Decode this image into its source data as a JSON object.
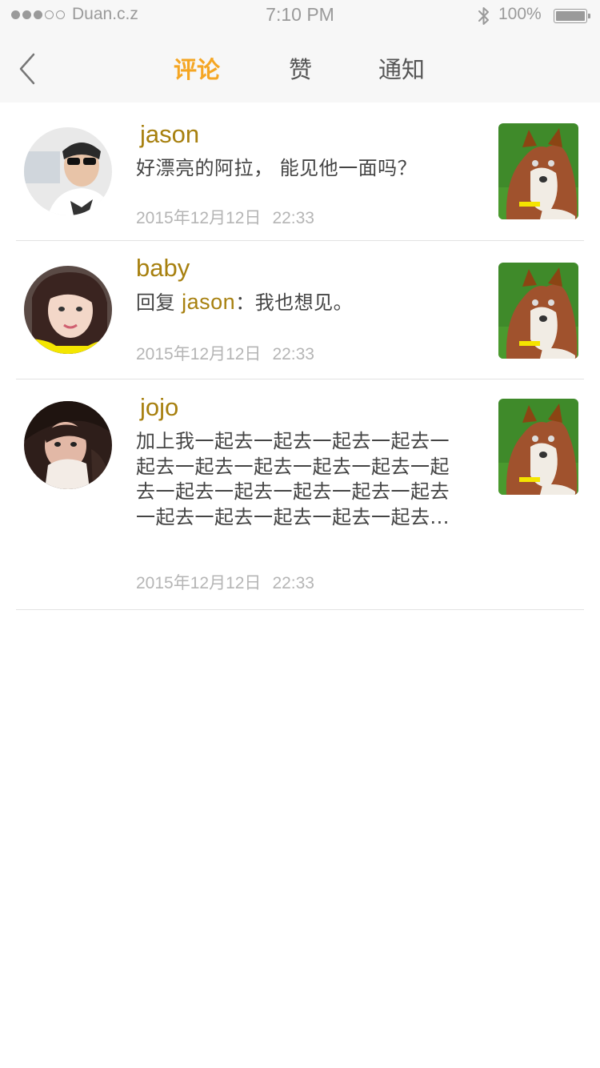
{
  "status_bar": {
    "carrier": "Duan.c.z",
    "time": "7:10 PM",
    "battery": "100%",
    "signal_dots_filled": 3,
    "signal_dots_total": 5
  },
  "nav": {
    "back_icon": "chevron-left-icon",
    "tabs": [
      {
        "label": "评论",
        "active": true
      },
      {
        "label": "赞",
        "active": false
      },
      {
        "label": "通知",
        "active": false
      }
    ]
  },
  "comments": [
    {
      "user": "jason",
      "text": "好漂亮的阿拉， 能见他一面吗？",
      "date": "2015年12月12日",
      "time": "22:33"
    },
    {
      "user": "baby",
      "reply_prefix": "回复 ",
      "reply_to": "jason",
      "reply_sep": "：",
      "text": "我也想见。",
      "date": "2015年12月12日",
      "time": "22:33"
    },
    {
      "user": "jojo",
      "text": "加上我一起去一起去一起去一起去一起去一起去一起去一起去一起去一起去一起去一起去一起去一起去一起去一起去一起去一起去一起去一起去...",
      "date": "2015年12月12日",
      "time": "22:33"
    }
  ],
  "colors": {
    "accent_tab": "#f5a623",
    "username": "#a7800f",
    "meta_text": "#b5b5b5"
  }
}
